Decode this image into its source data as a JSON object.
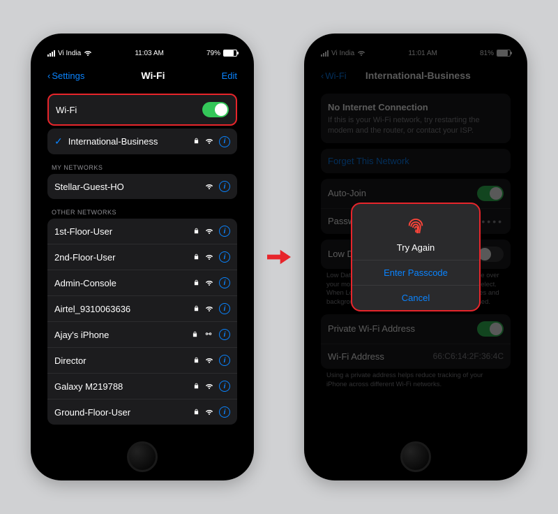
{
  "phone1": {
    "status": {
      "carrier": "Vi India",
      "time": "11:03 AM",
      "battery": "79%"
    },
    "nav": {
      "back": "Settings",
      "title": "Wi-Fi",
      "edit": "Edit"
    },
    "wifi_row": {
      "label": "Wi-Fi",
      "toggle_on": true
    },
    "connected": {
      "name": "International-Business"
    },
    "my_networks_hdr": "MY NETWORKS",
    "my_networks": [
      {
        "name": "Stellar-Guest-HO"
      }
    ],
    "other_hdr": "OTHER NETWORKS",
    "other_networks": [
      {
        "name": "1st-Floor-User",
        "locked": true
      },
      {
        "name": "2nd-Floor-User",
        "locked": true
      },
      {
        "name": "Admin-Console",
        "locked": true
      },
      {
        "name": "Airtel_9310063636",
        "locked": true
      },
      {
        "name": "Ajay's iPhone",
        "locked": true,
        "hotspot": true
      },
      {
        "name": "Director",
        "locked": true
      },
      {
        "name": "Galaxy M219788",
        "locked": true
      },
      {
        "name": "Ground-Floor-User",
        "locked": true
      }
    ]
  },
  "phone2": {
    "status": {
      "carrier": "Vi India",
      "time": "11:01 AM",
      "battery": "81%"
    },
    "nav": {
      "back": "Wi-Fi",
      "title": "International-Business"
    },
    "no_internet": {
      "title": "No Internet Connection",
      "body": "If this is your Wi-Fi network, try restarting the modem and the router, or contact your ISP."
    },
    "forget": "Forget This Network",
    "auto_join": {
      "label": "Auto-Join"
    },
    "password": {
      "label": "Password",
      "value": "••••••••"
    },
    "low_data": {
      "label": "Low Data Mode",
      "desc": "Low Data Mode helps reduce your iPhone data usage over your mobile network or specific Wi-Fi networks you select. When Low Data Mode is turned on, automatic updates and background tasks, such as Photos syncing, are paused."
    },
    "private_addr": {
      "label": "Private Wi-Fi Address"
    },
    "wifi_addr": {
      "label": "Wi-Fi Address",
      "value": "66:C6:14:2F:36:4C"
    },
    "private_desc": "Using a private address helps reduce tracking of your iPhone across different Wi-Fi networks.",
    "dialog": {
      "title": "Try Again",
      "enter": "Enter Passcode",
      "cancel": "Cancel"
    }
  }
}
